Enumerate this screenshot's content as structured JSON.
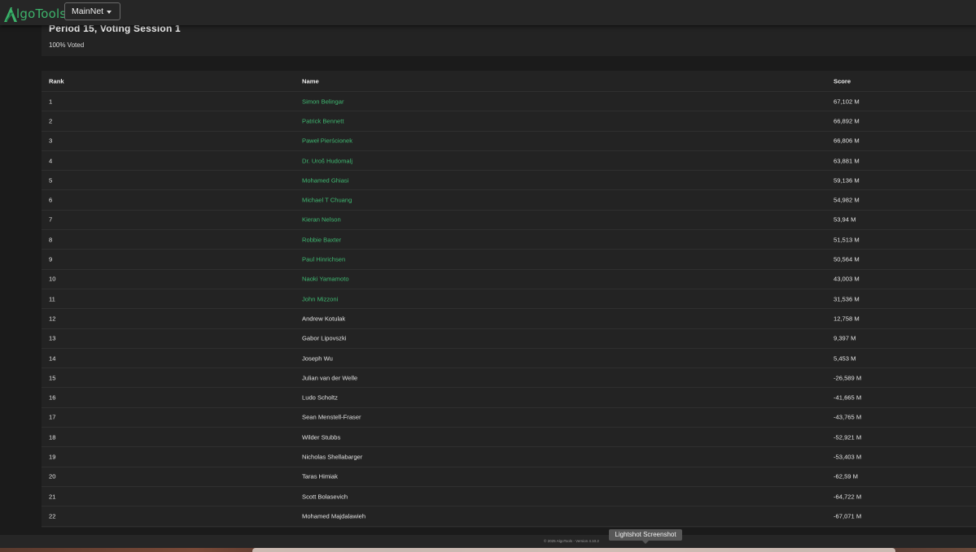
{
  "app": {
    "logo_text": "lgoTools",
    "network": "MainNet"
  },
  "session": {
    "title": "Period 15, Voting Session 1",
    "voted": "100% Voted"
  },
  "table": {
    "columns": [
      "Rank",
      "Name",
      "Score"
    ],
    "rows": [
      {
        "rank": "1",
        "name": "Simon Belingar",
        "score": "67,102 M",
        "link": true
      },
      {
        "rank": "2",
        "name": "Patrick Bennett",
        "score": "66,892 M",
        "link": true
      },
      {
        "rank": "3",
        "name": "Paweł Pierścionek",
        "score": "66,806 M",
        "link": true
      },
      {
        "rank": "4",
        "name": "Dr. Uroš Hudomalj",
        "score": "63,881 M",
        "link": true
      },
      {
        "rank": "5",
        "name": "Mohamed Ghiasi",
        "score": "59,136 M",
        "link": true
      },
      {
        "rank": "6",
        "name": "Michael T Chuang",
        "score": "54,982 M",
        "link": true
      },
      {
        "rank": "7",
        "name": "Kieran Nelson",
        "score": "53,94 M",
        "link": true
      },
      {
        "rank": "8",
        "name": "Robbie Baxter",
        "score": "51,513 M",
        "link": true
      },
      {
        "rank": "9",
        "name": "Paul Hinrichsen",
        "score": "50,564 M",
        "link": true
      },
      {
        "rank": "10",
        "name": "Naoki Yamamoto",
        "score": "43,003 M",
        "link": true
      },
      {
        "rank": "11",
        "name": "John Mizzoni",
        "score": "31,536 M",
        "link": true
      },
      {
        "rank": "12",
        "name": "Andrew Kotulak",
        "score": "12,758 M",
        "link": false
      },
      {
        "rank": "13",
        "name": "Gabor Lipovszki",
        "score": "9,397 M",
        "link": false
      },
      {
        "rank": "14",
        "name": "Joseph Wu",
        "score": "5,453 M",
        "link": false
      },
      {
        "rank": "15",
        "name": "Julian van der Welle",
        "score": "-26,589 M",
        "link": false
      },
      {
        "rank": "16",
        "name": "Ludo Scholtz",
        "score": "-41,665 M",
        "link": false
      },
      {
        "rank": "17",
        "name": "Sean Menstell-Fraser",
        "score": "-43,765 M",
        "link": false
      },
      {
        "rank": "18",
        "name": "Wilder Stubbs",
        "score": "-52,921 M",
        "link": false
      },
      {
        "rank": "19",
        "name": "Nicholas Shellabarger",
        "score": "-53,403 M",
        "link": false
      },
      {
        "rank": "20",
        "name": "Taras Himiak",
        "score": "-62,59 M",
        "link": false
      },
      {
        "rank": "21",
        "name": "Scott Bolasevich",
        "score": "-64,722 M",
        "link": false
      },
      {
        "rank": "22",
        "name": "Mohamed Majdalawieh",
        "score": "-67,071 M",
        "link": false
      }
    ]
  },
  "footer": {
    "copyright": "© 2025 AlgoTools - Version 4.10.2"
  },
  "tooltip": {
    "text": "Lightshot Screenshot"
  },
  "colors": {
    "accent": "#3fb871",
    "background": "#1b1b1b",
    "card": "#232323"
  }
}
